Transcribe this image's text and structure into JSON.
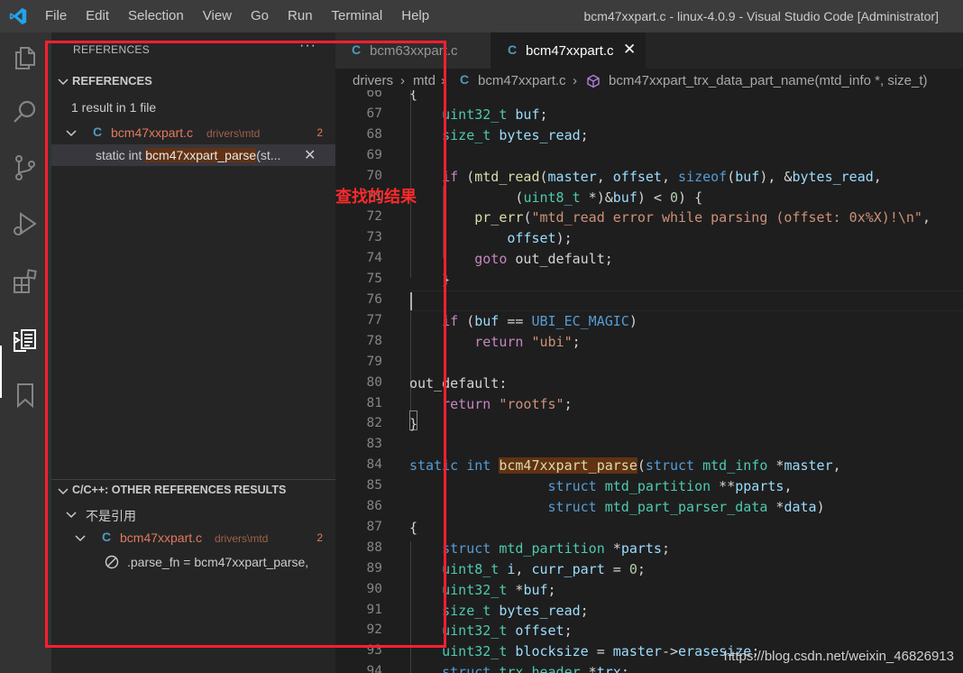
{
  "window": {
    "title": "bcm47xxpart.c - linux-4.0.9 - Visual Studio Code [Administrator]",
    "menu": [
      "File",
      "Edit",
      "Selection",
      "View",
      "Go",
      "Run",
      "Terminal",
      "Help"
    ]
  },
  "activity_bar": {
    "icons": [
      "explorer-icon",
      "search-icon",
      "source-control-icon",
      "run-debug-icon",
      "extensions-icon",
      "references-icon",
      "bookmarks-icon"
    ],
    "active": "references-icon"
  },
  "sidebar": {
    "header": "REFERENCES",
    "more": "···",
    "references": {
      "title": "REFERENCES",
      "summary": "1 result in 1 file",
      "file": {
        "badge": "C",
        "name": "bcm47xxpart.c",
        "path": "drivers\\mtd",
        "count": "2"
      },
      "match": {
        "prefix": "static int ",
        "highlight": "bcm47xxpart_parse",
        "suffix": "(st...",
        "close": "✕"
      }
    },
    "other_references": {
      "title": "C/C++: OTHER REFERENCES RESULTS",
      "group": "不是引用",
      "file": {
        "badge": "C",
        "name": "bcm47xxpart.c",
        "path": "drivers\\mtd",
        "count": "2"
      },
      "match": ".parse_fn = bcm47xxpart_parse,"
    }
  },
  "annotation": {
    "text": "查找的结果",
    "color": "#ff1f2f"
  },
  "tabs": [
    {
      "badge": "C",
      "label": "bcm63xxpart.c",
      "active": false
    },
    {
      "badge": "C",
      "label": "bcm47xxpart.c",
      "active": true,
      "close": "✕"
    }
  ],
  "breadcrumb": {
    "items": [
      "drivers",
      "mtd"
    ],
    "file_badge": "C",
    "file": "bcm47xxpart.c",
    "symbol": "bcm47xxpart_trx_data_part_name(mtd_info *, size_t)"
  },
  "editor": {
    "lines": [
      {
        "n": "66",
        "t": [
          [
            "{",
            ""
          ]
        ]
      },
      {
        "n": "67",
        "t": [
          [
            "    ",
            ""
          ],
          [
            "uint32_t",
            "type"
          ],
          [
            " ",
            ""
          ],
          [
            "buf",
            "var"
          ],
          [
            ";",
            ""
          ]
        ]
      },
      {
        "n": "68",
        "t": [
          [
            "    ",
            ""
          ],
          [
            "size_t",
            "type"
          ],
          [
            " ",
            ""
          ],
          [
            "bytes_read",
            "var"
          ],
          [
            ";",
            ""
          ]
        ]
      },
      {
        "n": "69",
        "t": [
          [
            "",
            ""
          ]
        ]
      },
      {
        "n": "70",
        "t": [
          [
            "    ",
            ""
          ],
          [
            "if",
            "ctrl"
          ],
          [
            " (",
            ""
          ],
          [
            "mtd_read",
            "fn"
          ],
          [
            "(",
            ""
          ],
          [
            "master",
            "var"
          ],
          [
            ", ",
            ""
          ],
          [
            "offset",
            "var"
          ],
          [
            ", ",
            ""
          ],
          [
            "sizeof",
            "kw"
          ],
          [
            "(",
            ""
          ],
          [
            "buf",
            "var"
          ],
          [
            "), &",
            ""
          ],
          [
            "bytes_read",
            "var"
          ],
          [
            ",",
            ""
          ]
        ]
      },
      {
        "n": "71",
        "t": [
          [
            "             (",
            ""
          ],
          [
            "uint8_t",
            "type"
          ],
          [
            " *)&",
            ""
          ],
          [
            "buf",
            "var"
          ],
          [
            ") < ",
            ""
          ],
          [
            "0",
            "num"
          ],
          [
            ") {",
            ""
          ]
        ]
      },
      {
        "n": "72",
        "t": [
          [
            "        ",
            ""
          ],
          [
            "pr_err",
            "fn"
          ],
          [
            "(",
            ""
          ],
          [
            "\"mtd_read error while parsing (offset: 0x%X)!\\n\"",
            "str"
          ],
          [
            ",",
            ""
          ]
        ]
      },
      {
        "n": "73",
        "t": [
          [
            "            ",
            ""
          ],
          [
            "offset",
            "var"
          ],
          [
            ");",
            ""
          ]
        ]
      },
      {
        "n": "74",
        "t": [
          [
            "        ",
            ""
          ],
          [
            "goto",
            "ctrl"
          ],
          [
            " out_default;",
            ""
          ]
        ]
      },
      {
        "n": "75",
        "t": [
          [
            "    }",
            ""
          ]
        ]
      },
      {
        "n": "76",
        "t": [
          [
            "",
            ""
          ]
        ]
      },
      {
        "n": "77",
        "t": [
          [
            "    ",
            ""
          ],
          [
            "if",
            "ctrl"
          ],
          [
            " (",
            ""
          ],
          [
            "buf",
            "var"
          ],
          [
            " == ",
            ""
          ],
          [
            "UBI_EC_MAGIC",
            "macro"
          ],
          [
            ")",
            ""
          ]
        ]
      },
      {
        "n": "78",
        "t": [
          [
            "        ",
            ""
          ],
          [
            "return",
            "ctrl"
          ],
          [
            " ",
            ""
          ],
          [
            "\"ubi\"",
            "str"
          ],
          [
            ";",
            ""
          ]
        ]
      },
      {
        "n": "79",
        "t": [
          [
            "",
            ""
          ]
        ]
      },
      {
        "n": "80",
        "t": [
          [
            "out_default:",
            ""
          ]
        ]
      },
      {
        "n": "81",
        "t": [
          [
            "    ",
            ""
          ],
          [
            "return",
            "ctrl"
          ],
          [
            " ",
            ""
          ],
          [
            "\"rootfs\"",
            "str"
          ],
          [
            ";",
            ""
          ]
        ]
      },
      {
        "n": "82",
        "t": [
          [
            "}",
            ""
          ]
        ]
      },
      {
        "n": "83",
        "t": [
          [
            "",
            ""
          ]
        ]
      },
      {
        "n": "84",
        "t": [
          [
            "static",
            "kw"
          ],
          [
            " ",
            ""
          ],
          [
            "int",
            "kw"
          ],
          [
            " ",
            ""
          ],
          [
            "bcm47xxpart_parse",
            "fnhl"
          ],
          [
            "(",
            ""
          ],
          [
            "struct",
            "kw"
          ],
          [
            " ",
            ""
          ],
          [
            "mtd_info",
            "type"
          ],
          [
            " *",
            ""
          ],
          [
            "master",
            "var"
          ],
          [
            ",",
            ""
          ]
        ]
      },
      {
        "n": "85",
        "t": [
          [
            "                 ",
            ""
          ],
          [
            "struct",
            "kw"
          ],
          [
            " ",
            ""
          ],
          [
            "mtd_partition",
            "type"
          ],
          [
            " **",
            ""
          ],
          [
            "pparts",
            "var"
          ],
          [
            ",",
            ""
          ]
        ]
      },
      {
        "n": "86",
        "t": [
          [
            "                 ",
            ""
          ],
          [
            "struct",
            "kw"
          ],
          [
            " ",
            ""
          ],
          [
            "mtd_part_parser_data",
            "type"
          ],
          [
            " *",
            ""
          ],
          [
            "data",
            "var"
          ],
          [
            ")",
            ""
          ]
        ]
      },
      {
        "n": "87",
        "t": [
          [
            "{",
            ""
          ]
        ]
      },
      {
        "n": "88",
        "t": [
          [
            "    ",
            ""
          ],
          [
            "struct",
            "kw"
          ],
          [
            " ",
            ""
          ],
          [
            "mtd_partition",
            "type"
          ],
          [
            " *",
            ""
          ],
          [
            "parts",
            "var"
          ],
          [
            ";",
            ""
          ]
        ]
      },
      {
        "n": "89",
        "t": [
          [
            "    ",
            ""
          ],
          [
            "uint8_t",
            "type"
          ],
          [
            " ",
            ""
          ],
          [
            "i",
            "var"
          ],
          [
            ", ",
            ""
          ],
          [
            "curr_part",
            "var"
          ],
          [
            " = ",
            ""
          ],
          [
            "0",
            "num"
          ],
          [
            ";",
            ""
          ]
        ]
      },
      {
        "n": "90",
        "t": [
          [
            "    ",
            ""
          ],
          [
            "uint32_t",
            "type"
          ],
          [
            " *",
            ""
          ],
          [
            "buf",
            "var"
          ],
          [
            ";",
            ""
          ]
        ]
      },
      {
        "n": "91",
        "t": [
          [
            "    ",
            ""
          ],
          [
            "size_t",
            "type"
          ],
          [
            " ",
            ""
          ],
          [
            "bytes_read",
            "var"
          ],
          [
            ";",
            ""
          ]
        ]
      },
      {
        "n": "92",
        "t": [
          [
            "    ",
            ""
          ],
          [
            "uint32_t",
            "type"
          ],
          [
            " ",
            ""
          ],
          [
            "offset",
            "var"
          ],
          [
            ";",
            ""
          ]
        ]
      },
      {
        "n": "93",
        "t": [
          [
            "    ",
            ""
          ],
          [
            "uint32_t",
            "type"
          ],
          [
            " ",
            ""
          ],
          [
            "blocksize",
            "var"
          ],
          [
            " = ",
            ""
          ],
          [
            "master",
            "var"
          ],
          [
            "->",
            ""
          ],
          [
            "erasesize",
            "var"
          ],
          [
            ";",
            ""
          ]
        ]
      },
      {
        "n": "94",
        "t": [
          [
            "    ",
            ""
          ],
          [
            "struct",
            "kw"
          ],
          [
            " ",
            ""
          ],
          [
            "trx_header",
            "type"
          ],
          [
            " *",
            ""
          ],
          [
            "trx",
            "var"
          ],
          [
            ";",
            ""
          ]
        ]
      }
    ]
  },
  "watermark": "https://blog.csdn.net/weixin_46826913"
}
